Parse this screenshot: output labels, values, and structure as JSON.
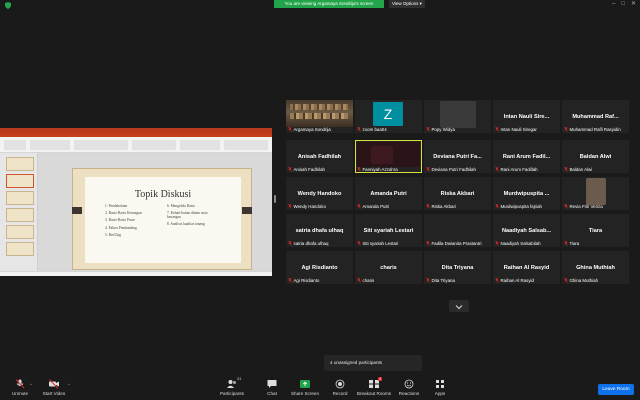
{
  "topbar": {
    "share_banner": "You are viewing Argamaya Sondrija's screen",
    "view_options": "View Options ▾",
    "min_icon": "minimize-icon",
    "max_icon": "maximize-icon",
    "close_icon": "close-icon"
  },
  "slide": {
    "title": "Topik Diskusi",
    "left_items": [
      "1.   Pendahuluan",
      "2.   Rasio-Rasio Keuangan",
      "3.   Rasio-Rasio Pasar",
      "4.   Faktor Pembanding",
      "5.   Red flag"
    ],
    "right_items": [
      "6.   Mengelola Rasio",
      "7.   Kehati-hatian dalam rasio",
      "      keuangan",
      "8.   Analisis kualitas tanang"
    ]
  },
  "participants": [
    {
      "name": "Argamaya Sondrija",
      "display": "",
      "type": "video",
      "row": 0,
      "col": 0
    },
    {
      "name": "zoom baa04",
      "display": "",
      "type": "avatar",
      "avatar_letter": "Z",
      "row": 0,
      "col": 1
    },
    {
      "name": "Popy Widya",
      "display": "",
      "type": "blur",
      "row": 0,
      "col": 2
    },
    {
      "name": "Intan Nauli Siregar",
      "display": "Intan Nauli Sire...",
      "type": "name",
      "row": 0,
      "col": 3
    },
    {
      "name": "Muhammad Rafli Rasyidin",
      "display": "Muhammad Raf...",
      "type": "name",
      "row": 0,
      "col": 4
    },
    {
      "name": "Anisah Fadhilah",
      "display": "Anisah Fadhilah",
      "type": "name",
      "row": 1,
      "col": 0
    },
    {
      "name": "Fanniyah Azzahra",
      "display": "",
      "type": "video-dark",
      "row": 1,
      "col": 1,
      "active": true
    },
    {
      "name": "Deviana Putri Fadhilah",
      "display": "Deviana Putri Fa...",
      "type": "name",
      "row": 1,
      "col": 2
    },
    {
      "name": "Rani Arum Fadillah",
      "display": "Rani Arum Fadil...",
      "type": "name",
      "row": 1,
      "col": 3
    },
    {
      "name": "Baldan Alwi",
      "display": "Baldan Alwi",
      "type": "name",
      "row": 1,
      "col": 4
    },
    {
      "name": "Wendy Handoko",
      "display": "Wendy Handoko",
      "type": "name",
      "row": 2,
      "col": 0
    },
    {
      "name": "Amanda Putri",
      "display": "Amanda Putri",
      "type": "name",
      "row": 2,
      "col": 1
    },
    {
      "name": "Riska Akbari",
      "display": "Riska Akbari",
      "type": "name",
      "row": 2,
      "col": 2
    },
    {
      "name": "Murdwipuspita fajriah",
      "display": "Murdwipuspita ...",
      "type": "name",
      "row": 2,
      "col": 3
    },
    {
      "name": "Revia Fitri Veriza",
      "display": "",
      "type": "blur-small",
      "row": 2,
      "col": 4
    },
    {
      "name": "satria dhafa ulhaq",
      "display": "satria dhafa ulhaq",
      "type": "name",
      "row": 3,
      "col": 0
    },
    {
      "name": "Siti syariah Lestari",
      "display": "Siti syariah Lestari",
      "type": "name",
      "row": 3,
      "col": 1
    },
    {
      "name": "Fadila Dwianita Prastantri",
      "display": "",
      "type": "empty",
      "row": 3,
      "col": 2
    },
    {
      "name": "Naadiyah Salsabilah",
      "display": "Naadiyah Salsab...",
      "type": "name",
      "row": 3,
      "col": 3
    },
    {
      "name": "Tiara",
      "display": "Tiara",
      "type": "name",
      "row": 3,
      "col": 4
    },
    {
      "name": "Agi Risdianto",
      "display": "Agi Risdianto",
      "type": "name",
      "row": 4,
      "col": 0
    },
    {
      "name": "charis",
      "display": "charis",
      "type": "name",
      "row": 4,
      "col": 1
    },
    {
      "name": "Dita Triyana",
      "display": "Dita Triyana",
      "type": "name",
      "row": 4,
      "col": 2
    },
    {
      "name": "Raihan Al Rasyid",
      "display": "Raihan Al Rasyid",
      "type": "name",
      "row": 4,
      "col": 3
    },
    {
      "name": "Ghina Muthiah",
      "display": "Ghina Muthiah",
      "type": "name",
      "row": 4,
      "col": 4
    }
  ],
  "unassigned": "4 unassigned participants",
  "toolbar": {
    "unmute": "Unmute",
    "start_video": "Start Video",
    "participants": "Participants",
    "participants_count": "31",
    "chat": "Chat",
    "share_screen": "Share Screen",
    "record": "Record",
    "breakout_rooms": "Breakout Rooms",
    "reactions": "Reactions",
    "apps": "Apps",
    "leave": "Leave Room"
  },
  "colors": {
    "share_banner": "#22a54a",
    "active_speaker": "#d6e03a",
    "leave": "#0e72ed",
    "muted_icon": "#e02828",
    "zoom_avatar": "#008fa0"
  }
}
